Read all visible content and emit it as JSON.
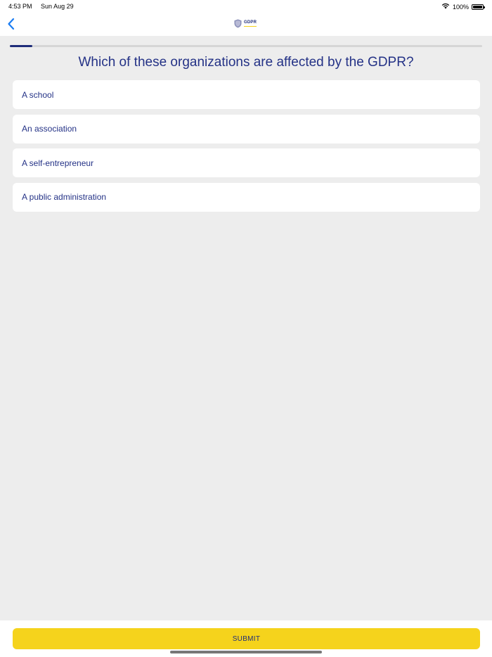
{
  "status_bar": {
    "time": "4:53 PM",
    "date": "Sun Aug 29",
    "battery": "100%",
    "icons": [
      "wifi-icon",
      "battery-icon"
    ]
  },
  "nav": {
    "back_icon": "chevron-left-icon",
    "logo_text": "GDPR"
  },
  "progress": {
    "value": 0.047
  },
  "question": {
    "text": "Which of these organizations are affected by the GDPR?"
  },
  "options": [
    {
      "label": "A school"
    },
    {
      "label": "An association"
    },
    {
      "label": "A self-entrepreneur"
    },
    {
      "label": "A public administration"
    }
  ],
  "submit": {
    "label": "SUBMIT"
  },
  "colors": {
    "primary": "#243286",
    "accent": "#f5d31c",
    "background": "#ededed",
    "ios_blue": "#1a7cf2"
  }
}
